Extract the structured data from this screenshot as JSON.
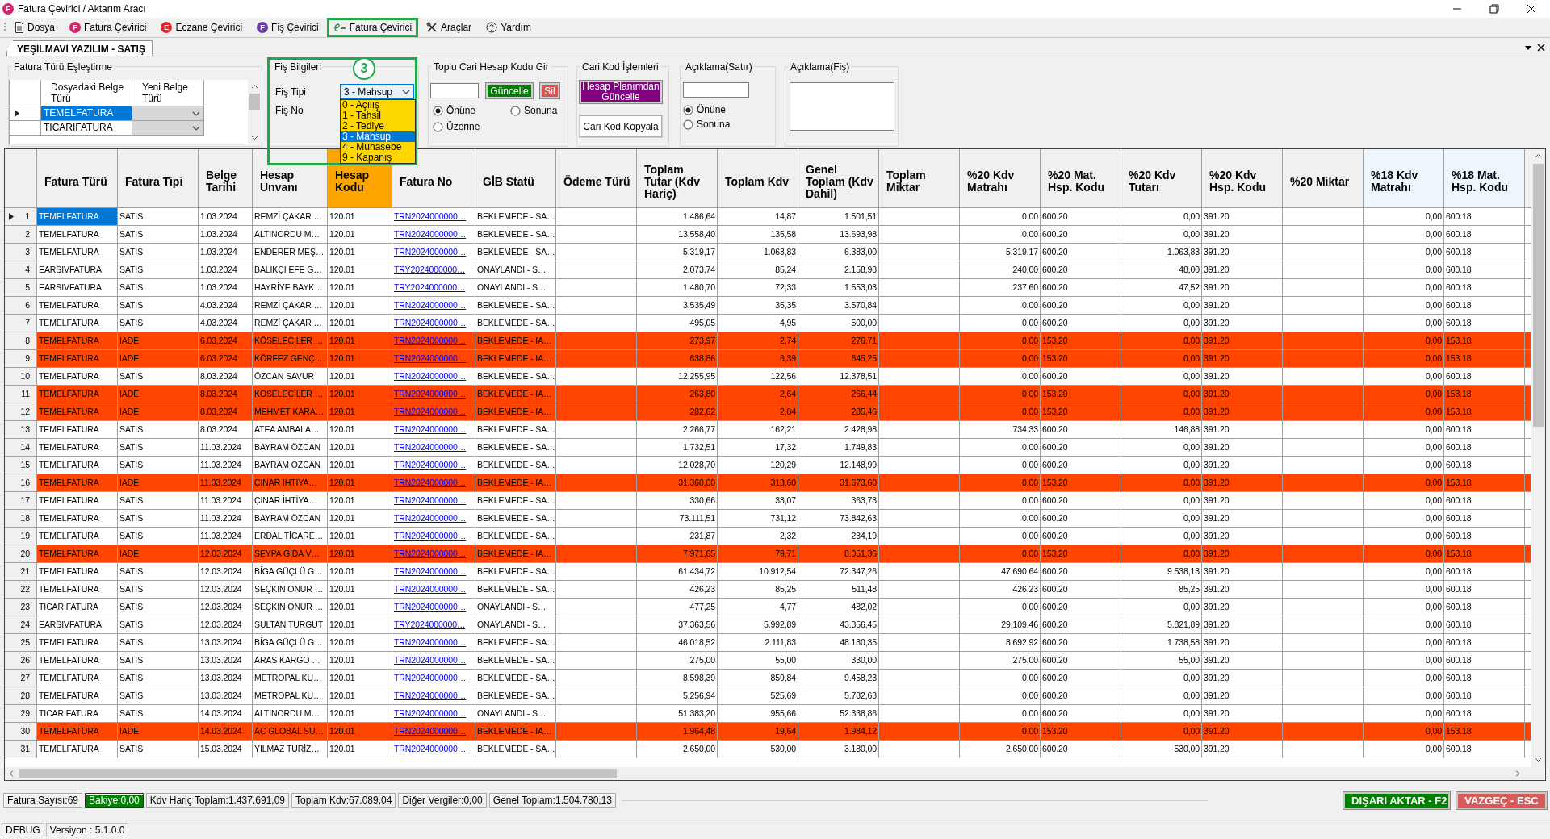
{
  "window": {
    "title": "Fatura Çevirici / Aktarım Aracı",
    "badge": "F"
  },
  "menu": [
    {
      "label": "Dosya",
      "kind": "document"
    },
    {
      "label": "Fatura Çevirici",
      "kind": "badge",
      "badge": "F",
      "color": "#d6246e"
    },
    {
      "label": "Eczane Çevirici",
      "kind": "badge",
      "badge": "E",
      "color": "#e3262b"
    },
    {
      "label": "Fiş Çevirici",
      "kind": "badge",
      "badge": "F",
      "color": "#6b3fa0"
    },
    {
      "label": "Fatura Çevirici",
      "kind": "efatura",
      "highlighted": true
    },
    {
      "label": "Araçlar",
      "kind": "tools"
    },
    {
      "label": "Yardım",
      "kind": "help"
    }
  ],
  "document_tab": {
    "label": "YEŞİLMAVİ YAZILIM - SATIŞ",
    "selected": true
  },
  "mapping": {
    "title": "Fatura Türü Eşleştirme",
    "columns": [
      "Dosyadaki Belge Türü",
      "Yeni Belge Türü"
    ],
    "rows": [
      {
        "source": "TEMELFATURA",
        "selected": true
      },
      {
        "source": "TICARIFATURA",
        "selected": false
      }
    ]
  },
  "voucher": {
    "title": "Fiş Bilgileri",
    "highlighted": true,
    "badge": "3",
    "type_label": "Fiş Tipi",
    "type_value": "3 - Mahsup",
    "number_label": "Fiş No",
    "expanded": true,
    "options": [
      {
        "label": "0 - Açılış",
        "selected": false
      },
      {
        "label": "1 - Tahsil",
        "selected": false
      },
      {
        "label": "2 - Tediye",
        "selected": false
      },
      {
        "label": "3 - Mahsup",
        "selected": true
      },
      {
        "label": "4 - Muhasebe",
        "selected": false
      },
      {
        "label": "9 - Kapanış",
        "selected": false
      }
    ]
  },
  "bulk_account": {
    "title": "Toplu Cari Hesap Kodu Gir",
    "update_button": "Güncelle",
    "delete_button": "Sil",
    "positions": [
      {
        "label": "Önüne",
        "selected": true
      },
      {
        "label": "Sonuna",
        "selected": false
      },
      {
        "label": "Üzerine",
        "selected": false
      }
    ]
  },
  "account_ops": {
    "title": "Cari Kod İşlemleri",
    "buttons": [
      {
        "label": "Hesap Planımdan Güncelle",
        "kind": "primary"
      },
      {
        "label": "Cari Kod Kopyala",
        "kind": "plain"
      }
    ]
  },
  "line_note": {
    "title": "Açıklama(Satır)",
    "positions": [
      {
        "label": "Önüne",
        "selected": true
      },
      {
        "label": "Sonuna",
        "selected": false
      }
    ]
  },
  "voucher_note": {
    "title": "Açıklama(Fiş)"
  },
  "table": {
    "columns": [
      {
        "label": "Fatura Türü",
        "kind": "text"
      },
      {
        "label": "Fatura Tipi",
        "kind": "text"
      },
      {
        "label": "Belge Tarihi",
        "kind": "text"
      },
      {
        "label": "Hesap Unvanı",
        "kind": "text"
      },
      {
        "label": "Hesap Kodu",
        "kind": "text",
        "color": "#ffa500"
      },
      {
        "label": "Fatura No",
        "kind": "link"
      },
      {
        "label": "GİB Statü",
        "kind": "text"
      },
      {
        "label": "Ödeme Türü"
      },
      {
        "label": "Toplam Tutar (Kdv Hariç)",
        "kind": "amount"
      },
      {
        "label": "Toplam Kdv",
        "kind": "amount"
      },
      {
        "label": "Genel Toplam (Kdv Dahil)",
        "kind": "amount"
      },
      {
        "label": "Toplam Miktar"
      },
      {
        "label": "%20 Kdv Matrahı",
        "kind": "amount"
      },
      {
        "label": "%20 Mat. Hsp. Kodu",
        "kind": "text"
      },
      {
        "label": "%20 Kdv Tutarı",
        "kind": "amount"
      },
      {
        "label": "%20 Kdv Hsp. Kodu",
        "kind": "text"
      },
      {
        "label": "%20 Miktar"
      },
      {
        "label": "%18 Kdv Matrahı",
        "kind": "amount",
        "color": "#eef6fd"
      },
      {
        "label": "%18 Mat. Hsp. Kodu",
        "kind": "text",
        "color": "#eef6fd"
      }
    ],
    "rows": [
      {
        "number": "1",
        "selected": true,
        "highlight": false,
        "cells": [
          "TEMELFATURA",
          "SATIS",
          "1.03.2024",
          "REMZİ ÇAKAR …",
          "120.01",
          "TRN2024000000…",
          "BEKLEMEDE - SA…",
          null,
          "1.486,64",
          "14,87",
          "1.501,51",
          null,
          "0,00",
          "600.20",
          "0,00",
          "391.20",
          null,
          "0,00",
          "600.18"
        ]
      },
      {
        "number": "2",
        "selected": false,
        "highlight": false,
        "cells": [
          "TEMELFATURA",
          "SATIS",
          "1.03.2024",
          "ALTINORDU M…",
          "120.01",
          "TRN2024000000…",
          "BEKLEMEDE - SA…",
          null,
          "13.558,40",
          "135,58",
          "13.693,98",
          null,
          "0,00",
          "600.20",
          "0,00",
          "391.20",
          null,
          "0,00",
          "600.18"
        ]
      },
      {
        "number": "3",
        "selected": false,
        "highlight": false,
        "cells": [
          "TEMELFATURA",
          "SATIS",
          "1.03.2024",
          "ENDERER MEŞ…",
          "120.01",
          "TRN2024000000…",
          "BEKLEMEDE - SA…",
          null,
          "5.319,17",
          "1.063,83",
          "6.383,00",
          null,
          "5.319,17",
          "600.20",
          "1.063,83",
          "391.20",
          null,
          "0,00",
          "600.18"
        ]
      },
      {
        "number": "4",
        "selected": false,
        "highlight": false,
        "cells": [
          "EARSIVFATURA",
          "SATIS",
          "1.03.2024",
          "BALIKÇI EFE G…",
          "120.01",
          "TRY2024000000…",
          "ONAYLANDI - S…",
          null,
          "2.073,74",
          "85,24",
          "2.158,98",
          null,
          "240,00",
          "600.20",
          "48,00",
          "391.20",
          null,
          "0,00",
          "600.18"
        ]
      },
      {
        "number": "5",
        "selected": false,
        "highlight": false,
        "cells": [
          "EARSIVFATURA",
          "SATIS",
          "1.03.2024",
          "HAYRİYE BAYK…",
          "120.01",
          "TRY2024000000…",
          "ONAYLANDI - S…",
          null,
          "1.480,70",
          "72,33",
          "1.553,03",
          null,
          "237,60",
          "600.20",
          "47,52",
          "391.20",
          null,
          "0,00",
          "600.18"
        ]
      },
      {
        "number": "6",
        "selected": false,
        "highlight": false,
        "cells": [
          "TEMELFATURA",
          "SATIS",
          "4.03.2024",
          "REMZİ ÇAKAR …",
          "120.01",
          "TRN2024000000…",
          "BEKLEMEDE - SA…",
          null,
          "3.535,49",
          "35,35",
          "3.570,84",
          null,
          "0,00",
          "600.20",
          "0,00",
          "391.20",
          null,
          "0,00",
          "600.18"
        ]
      },
      {
        "number": "7",
        "selected": false,
        "highlight": false,
        "cells": [
          "TEMELFATURA",
          "SATIS",
          "4.03.2024",
          "REMZİ ÇAKAR …",
          "120.01",
          "TRN2024000000…",
          "BEKLEMEDE - SA…",
          null,
          "495,05",
          "4,95",
          "500,00",
          null,
          "0,00",
          "600.20",
          "0,00",
          "391.20",
          null,
          "0,00",
          "600.18"
        ]
      },
      {
        "number": "8",
        "selected": false,
        "highlight": true,
        "cells": [
          "TEMELFATURA",
          "IADE",
          "6.03.2024",
          "KÖSELECİLER …",
          "120.01",
          "TRN2024000000…",
          "BEKLEMEDE - IA…",
          null,
          "273,97",
          "2,74",
          "276,71",
          null,
          "0,00",
          "153.20",
          "0,00",
          "391.20",
          null,
          "0,00",
          "153.18"
        ]
      },
      {
        "number": "9",
        "selected": false,
        "highlight": true,
        "cells": [
          "TEMELFATURA",
          "IADE",
          "6.03.2024",
          "KÖRFEZ GENÇ …",
          "120.01",
          "TRN2024000000…",
          "BEKLEMEDE - IA…",
          null,
          "638,86",
          "6,39",
          "645,25",
          null,
          "0,00",
          "153.20",
          "0,00",
          "391.20",
          null,
          "0,00",
          "153.18"
        ]
      },
      {
        "number": "10",
        "selected": false,
        "highlight": false,
        "cells": [
          "TEMELFATURA",
          "SATIS",
          "8.03.2024",
          "ÖZCAN SAVUR",
          "120.01",
          "TRN2024000000…",
          "BEKLEMEDE - SA…",
          null,
          "12.255,95",
          "122,56",
          "12.378,51",
          null,
          "0,00",
          "600.20",
          "0,00",
          "391.20",
          null,
          "0,00",
          "600.18"
        ]
      },
      {
        "number": "11",
        "selected": false,
        "highlight": true,
        "cells": [
          "TEMELFATURA",
          "IADE",
          "8.03.2024",
          "KÖSELECİLER …",
          "120.01",
          "TRN2024000000…",
          "BEKLEMEDE - IA…",
          null,
          "263,80",
          "2,64",
          "266,44",
          null,
          "0,00",
          "153.20",
          "0,00",
          "391.20",
          null,
          "0,00",
          "153.18"
        ]
      },
      {
        "number": "12",
        "selected": false,
        "highlight": true,
        "cells": [
          "TEMELFATURA",
          "IADE",
          "8.03.2024",
          "MEHMET KARA…",
          "120.01",
          "TRN2024000000…",
          "BEKLEMEDE - IA…",
          null,
          "282,62",
          "2,84",
          "285,46",
          null,
          "0,00",
          "153.20",
          "0,00",
          "391.20",
          null,
          "0,00",
          "153.18"
        ]
      },
      {
        "number": "13",
        "selected": false,
        "highlight": false,
        "cells": [
          "TEMELFATURA",
          "SATIS",
          "8.03.2024",
          "ATEA AMBALA…",
          "120.01",
          "TRN2024000000…",
          "BEKLEMEDE - SA…",
          null,
          "2.266,77",
          "162,21",
          "2.428,98",
          null,
          "734,33",
          "600.20",
          "146,88",
          "391.20",
          null,
          "0,00",
          "600.18"
        ]
      },
      {
        "number": "14",
        "selected": false,
        "highlight": false,
        "cells": [
          "TEMELFATURA",
          "SATIS",
          "11.03.2024",
          "BAYRAM ÖZCAN",
          "120.01",
          "TRN2024000000…",
          "BEKLEMEDE - SA…",
          null,
          "1.732,51",
          "17,32",
          "1.749,83",
          null,
          "0,00",
          "600.20",
          "0,00",
          "391.20",
          null,
          "0,00",
          "600.18"
        ]
      },
      {
        "number": "15",
        "selected": false,
        "highlight": false,
        "cells": [
          "TEMELFATURA",
          "SATIS",
          "11.03.2024",
          "BAYRAM ÖZCAN",
          "120.01",
          "TRN2024000000…",
          "BEKLEMEDE - SA…",
          null,
          "12.028,70",
          "120,29",
          "12.148,99",
          null,
          "0,00",
          "600.20",
          "0,00",
          "391.20",
          null,
          "0,00",
          "600.18"
        ]
      },
      {
        "number": "16",
        "selected": false,
        "highlight": true,
        "cells": [
          "TEMELFATURA",
          "IADE",
          "11.03.2024",
          "ÇINAR İHTİYA…",
          "120.01",
          "TRN2024000000…",
          "BEKLEMEDE - IA…",
          null,
          "31.360,00",
          "313,60",
          "31.673,60",
          null,
          "0,00",
          "153.20",
          "0,00",
          "391.20",
          null,
          "0,00",
          "153.18"
        ]
      },
      {
        "number": "17",
        "selected": false,
        "highlight": false,
        "cells": [
          "TEMELFATURA",
          "SATIS",
          "11.03.2024",
          "ÇINAR İHTİYA…",
          "120.01",
          "TRN2024000000…",
          "BEKLEMEDE - SA…",
          null,
          "330,66",
          "33,07",
          "363,73",
          null,
          "0,00",
          "600.20",
          "0,00",
          "391.20",
          null,
          "0,00",
          "600.18"
        ]
      },
      {
        "number": "18",
        "selected": false,
        "highlight": false,
        "cells": [
          "TEMELFATURA",
          "SATIS",
          "11.03.2024",
          "BAYRAM ÖZCAN",
          "120.01",
          "TRN2024000000…",
          "BEKLEMEDE - SA…",
          null,
          "73.111,51",
          "731,12",
          "73.842,63",
          null,
          "0,00",
          "600.20",
          "0,00",
          "391.20",
          null,
          "0,00",
          "600.18"
        ]
      },
      {
        "number": "19",
        "selected": false,
        "highlight": false,
        "cells": [
          "TEMELFATURA",
          "SATIS",
          "11.03.2024",
          "ERDAL TİCARE…",
          "120.01",
          "TRN2024000000…",
          "BEKLEMEDE - SA…",
          null,
          "231,87",
          "2,32",
          "234,19",
          null,
          "0,00",
          "600.20",
          "0,00",
          "391.20",
          null,
          "0,00",
          "600.18"
        ]
      },
      {
        "number": "20",
        "selected": false,
        "highlight": true,
        "cells": [
          "TEMELFATURA",
          "IADE",
          "12.03.2024",
          "SEYPA GIDA V…",
          "120.01",
          "TRN2024000000…",
          "BEKLEMEDE - IA…",
          null,
          "7.971,65",
          "79,71",
          "8.051,36",
          null,
          "0,00",
          "153.20",
          "0,00",
          "391.20",
          null,
          "0,00",
          "153.18"
        ]
      },
      {
        "number": "21",
        "selected": false,
        "highlight": false,
        "cells": [
          "TEMELFATURA",
          "SATIS",
          "12.03.2024",
          "BİGA GÜÇLÜ G…",
          "120.01",
          "TRN2024000000…",
          "BEKLEMEDE - SA…",
          null,
          "61.434,72",
          "10.912,54",
          "72.347,26",
          null,
          "47.690,64",
          "600.20",
          "9.538,13",
          "391.20",
          null,
          "0,00",
          "600.18"
        ]
      },
      {
        "number": "22",
        "selected": false,
        "highlight": false,
        "cells": [
          "TEMELFATURA",
          "SATIS",
          "12.03.2024",
          "SEÇKIN ONUR …",
          "120.01",
          "TRN2024000000…",
          "BEKLEMEDE - SA…",
          null,
          "426,23",
          "85,25",
          "511,48",
          null,
          "426,23",
          "600.20",
          "85,25",
          "391.20",
          null,
          "0,00",
          "600.18"
        ]
      },
      {
        "number": "23",
        "selected": false,
        "highlight": false,
        "cells": [
          "TICARIFATURA",
          "SATIS",
          "12.03.2024",
          "SEÇKIN ONUR …",
          "120.01",
          "TRN2024000000…",
          "ONAYLANDI - S…",
          null,
          "477,25",
          "4,77",
          "482,02",
          null,
          "0,00",
          "600.20",
          "0,00",
          "391.20",
          null,
          "0,00",
          "600.18"
        ]
      },
      {
        "number": "24",
        "selected": false,
        "highlight": false,
        "cells": [
          "EARSIVFATURA",
          "SATIS",
          "12.03.2024",
          "SULTAN TURGUT",
          "120.01",
          "TRY2024000000…",
          "ONAYLANDI - S…",
          null,
          "37.363,56",
          "5.992,89",
          "43.356,45",
          null,
          "29.109,46",
          "600.20",
          "5.821,89",
          "391.20",
          null,
          "0,00",
          "600.18"
        ]
      },
      {
        "number": "25",
        "selected": false,
        "highlight": false,
        "cells": [
          "TEMELFATURA",
          "SATIS",
          "13.03.2024",
          "BİGA GÜÇLÜ G…",
          "120.01",
          "TRN2024000000…",
          "BEKLEMEDE - SA…",
          null,
          "46.018,52",
          "2.111,83",
          "48.130,35",
          null,
          "8.692,92",
          "600.20",
          "1.738,58",
          "391.20",
          null,
          "0,00",
          "600.18"
        ]
      },
      {
        "number": "26",
        "selected": false,
        "highlight": false,
        "cells": [
          "TEMELFATURA",
          "SATIS",
          "13.03.2024",
          "ARAS KARGO …",
          "120.01",
          "TRN2024000000…",
          "BEKLEMEDE - SA…",
          null,
          "275,00",
          "55,00",
          "330,00",
          null,
          "275,00",
          "600.20",
          "55,00",
          "391.20",
          null,
          "0,00",
          "600.18"
        ]
      },
      {
        "number": "27",
        "selected": false,
        "highlight": false,
        "cells": [
          "TEMELFATURA",
          "SATIS",
          "13.03.2024",
          "METROPAL KU…",
          "120.01",
          "TRN2024000000…",
          "BEKLEMEDE - SA…",
          null,
          "8.598,39",
          "859,84",
          "9.458,23",
          null,
          "0,00",
          "600.20",
          "0,00",
          "391.20",
          null,
          "0,00",
          "600.18"
        ]
      },
      {
        "number": "28",
        "selected": false,
        "highlight": false,
        "cells": [
          "TEMELFATURA",
          "SATIS",
          "13.03.2024",
          "METROPAL KU…",
          "120.01",
          "TRN2024000000…",
          "BEKLEMEDE - SA…",
          null,
          "5.256,94",
          "525,69",
          "5.782,63",
          null,
          "0,00",
          "600.20",
          "0,00",
          "391.20",
          null,
          "0,00",
          "600.18"
        ]
      },
      {
        "number": "29",
        "selected": false,
        "highlight": false,
        "cells": [
          "TICARIFATURA",
          "SATIS",
          "14.03.2024",
          "ALTINORDU M…",
          "120.01",
          "TRN2024000000…",
          "ONAYLANDI - S…",
          null,
          "51.383,20",
          "955,66",
          "52.338,86",
          null,
          "0,00",
          "600.20",
          "0,00",
          "391.20",
          null,
          "0,00",
          "600.18"
        ]
      },
      {
        "number": "30",
        "selected": false,
        "highlight": true,
        "cells": [
          "TEMELFATURA",
          "IADE",
          "14.03.2024",
          "AC GLOBAL SU…",
          "120.01",
          "TRN2024000000…",
          "BEKLEMEDE - IA…",
          null,
          "1.964,48",
          "19,64",
          "1.984,12",
          null,
          "0,00",
          "153.20",
          "0,00",
          "391.20",
          null,
          "0,00",
          "153.18"
        ]
      },
      {
        "number": "31",
        "selected": false,
        "highlight": false,
        "cells": [
          "TEMELFATURA",
          "SATIS",
          "15.03.2024",
          "YILMAZ TURİZ…",
          "120.01",
          "TRN2024000000…",
          "BEKLEMEDE - SA…",
          null,
          "2.650,00",
          "530,00",
          "3.180,00",
          null,
          "2.650,00",
          "600.20",
          "530,00",
          "391.20",
          null,
          "0,00",
          "600.18"
        ]
      }
    ]
  },
  "status_bar": {
    "items": [
      {
        "label": "Fatura Sayısı:69",
        "kind": "plain"
      },
      {
        "label": "Bakiye:0,00",
        "kind": "positive"
      },
      {
        "label": "Kdv Hariç Toplam:1.437.691,09",
        "kind": "plain"
      },
      {
        "label": "Toplam Kdv:67.089,04",
        "kind": "plain"
      },
      {
        "label": "Diğer Vergiler:0,00",
        "kind": "plain"
      },
      {
        "label": "Genel Toplam:1.504.780,13",
        "kind": "plain"
      }
    ],
    "buttons": [
      {
        "label": "DIŞARI AKTAR - F2",
        "kind": "confirm"
      },
      {
        "label": "VAZGEÇ - ESC",
        "kind": "cancel"
      }
    ]
  },
  "footer": [
    "DEBUG",
    "Versiyon : 5.1.0.0"
  ]
}
